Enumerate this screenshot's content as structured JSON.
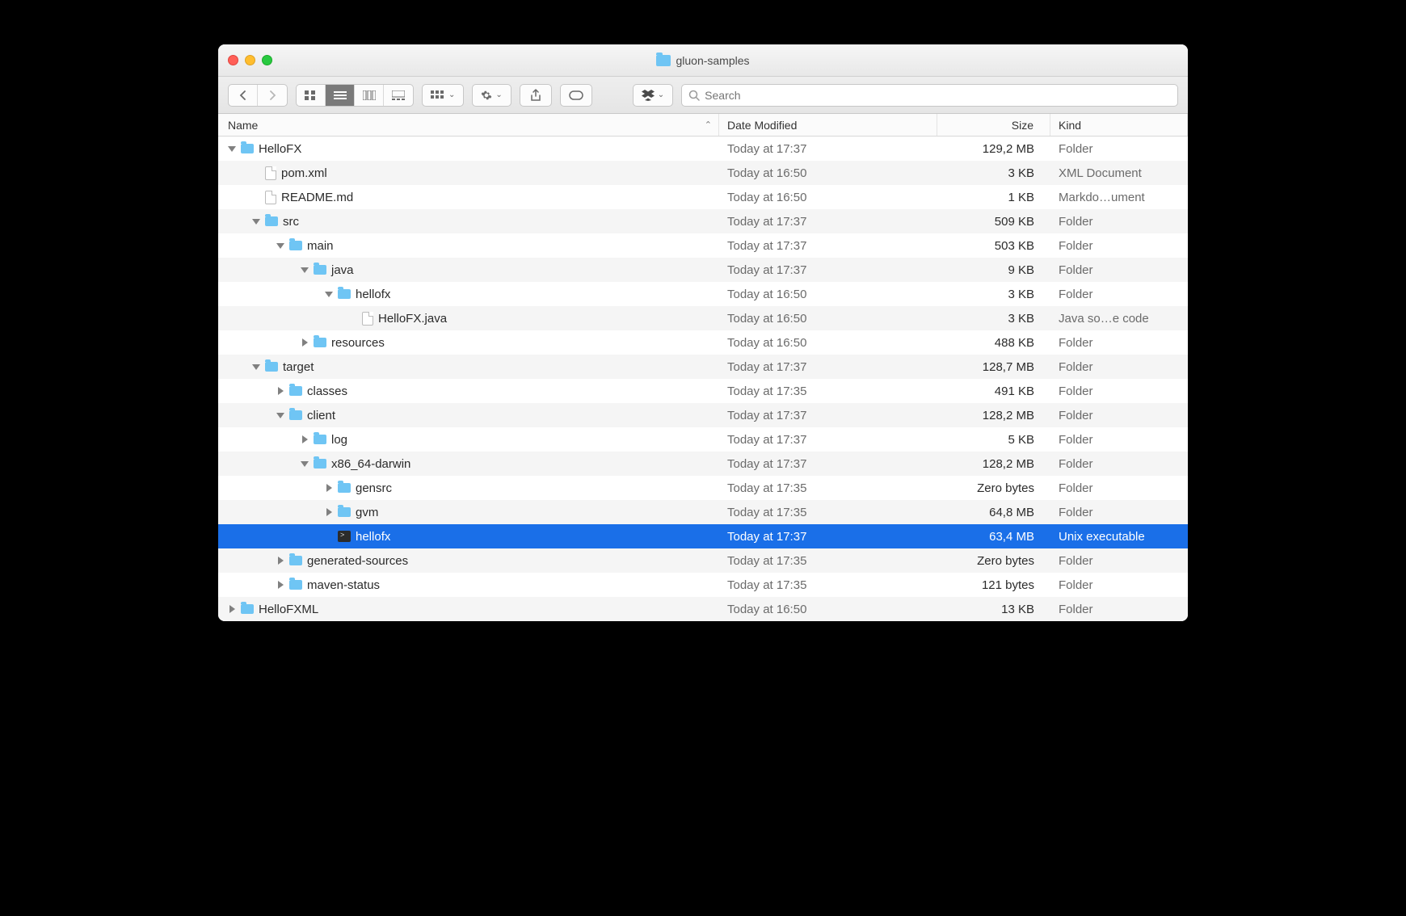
{
  "window": {
    "title": "gluon-samples"
  },
  "search": {
    "placeholder": "Search"
  },
  "columns": {
    "name": "Name",
    "date": "Date Modified",
    "size": "Size",
    "kind": "Kind"
  },
  "rows": [
    {
      "indent": 0,
      "disclosure": "open",
      "icon": "folder",
      "name": "HelloFX",
      "date": "Today at 17:37",
      "size": "129,2 MB",
      "kind": "Folder",
      "striped": false
    },
    {
      "indent": 1,
      "disclosure": "none",
      "icon": "file",
      "name": "pom.xml",
      "date": "Today at 16:50",
      "size": "3 KB",
      "kind": "XML Document",
      "striped": true
    },
    {
      "indent": 1,
      "disclosure": "none",
      "icon": "file",
      "name": "README.md",
      "date": "Today at 16:50",
      "size": "1 KB",
      "kind": "Markdo…ument",
      "striped": false
    },
    {
      "indent": 1,
      "disclosure": "open",
      "icon": "folder",
      "name": "src",
      "date": "Today at 17:37",
      "size": "509 KB",
      "kind": "Folder",
      "striped": true
    },
    {
      "indent": 2,
      "disclosure": "open",
      "icon": "folder",
      "name": "main",
      "date": "Today at 17:37",
      "size": "503 KB",
      "kind": "Folder",
      "striped": false
    },
    {
      "indent": 3,
      "disclosure": "open",
      "icon": "folder",
      "name": "java",
      "date": "Today at 17:37",
      "size": "9 KB",
      "kind": "Folder",
      "striped": true
    },
    {
      "indent": 4,
      "disclosure": "open",
      "icon": "folder",
      "name": "hellofx",
      "date": "Today at 16:50",
      "size": "3 KB",
      "kind": "Folder",
      "striped": false
    },
    {
      "indent": 5,
      "disclosure": "none",
      "icon": "file",
      "name": "HelloFX.java",
      "date": "Today at 16:50",
      "size": "3 KB",
      "kind": "Java so…e code",
      "striped": true
    },
    {
      "indent": 3,
      "disclosure": "closed",
      "icon": "folder",
      "name": "resources",
      "date": "Today at 16:50",
      "size": "488 KB",
      "kind": "Folder",
      "striped": false
    },
    {
      "indent": 1,
      "disclosure": "open",
      "icon": "folder",
      "name": "target",
      "date": "Today at 17:37",
      "size": "128,7 MB",
      "kind": "Folder",
      "striped": true
    },
    {
      "indent": 2,
      "disclosure": "closed",
      "icon": "folder",
      "name": "classes",
      "date": "Today at 17:35",
      "size": "491 KB",
      "kind": "Folder",
      "striped": false
    },
    {
      "indent": 2,
      "disclosure": "open",
      "icon": "folder",
      "name": "client",
      "date": "Today at 17:37",
      "size": "128,2 MB",
      "kind": "Folder",
      "striped": true
    },
    {
      "indent": 3,
      "disclosure": "closed",
      "icon": "folder",
      "name": "log",
      "date": "Today at 17:37",
      "size": "5 KB",
      "kind": "Folder",
      "striped": false
    },
    {
      "indent": 3,
      "disclosure": "open",
      "icon": "folder",
      "name": "x86_64-darwin",
      "date": "Today at 17:37",
      "size": "128,2 MB",
      "kind": "Folder",
      "striped": true
    },
    {
      "indent": 4,
      "disclosure": "closed",
      "icon": "folder",
      "name": "gensrc",
      "date": "Today at 17:35",
      "size": "Zero bytes",
      "kind": "Folder",
      "striped": false
    },
    {
      "indent": 4,
      "disclosure": "closed",
      "icon": "folder",
      "name": "gvm",
      "date": "Today at 17:35",
      "size": "64,8 MB",
      "kind": "Folder",
      "striped": true
    },
    {
      "indent": 4,
      "disclosure": "none",
      "icon": "exec",
      "name": "hellofx",
      "date": "Today at 17:37",
      "size": "63,4 MB",
      "kind": "Unix executable",
      "striped": false,
      "selected": true
    },
    {
      "indent": 2,
      "disclosure": "closed",
      "icon": "folder",
      "name": "generated-sources",
      "date": "Today at 17:35",
      "size": "Zero bytes",
      "kind": "Folder",
      "striped": true
    },
    {
      "indent": 2,
      "disclosure": "closed",
      "icon": "folder",
      "name": "maven-status",
      "date": "Today at 17:35",
      "size": "121 bytes",
      "kind": "Folder",
      "striped": false
    },
    {
      "indent": 0,
      "disclosure": "closed",
      "icon": "folder",
      "name": "HelloFXML",
      "date": "Today at 16:50",
      "size": "13 KB",
      "kind": "Folder",
      "striped": true
    }
  ]
}
